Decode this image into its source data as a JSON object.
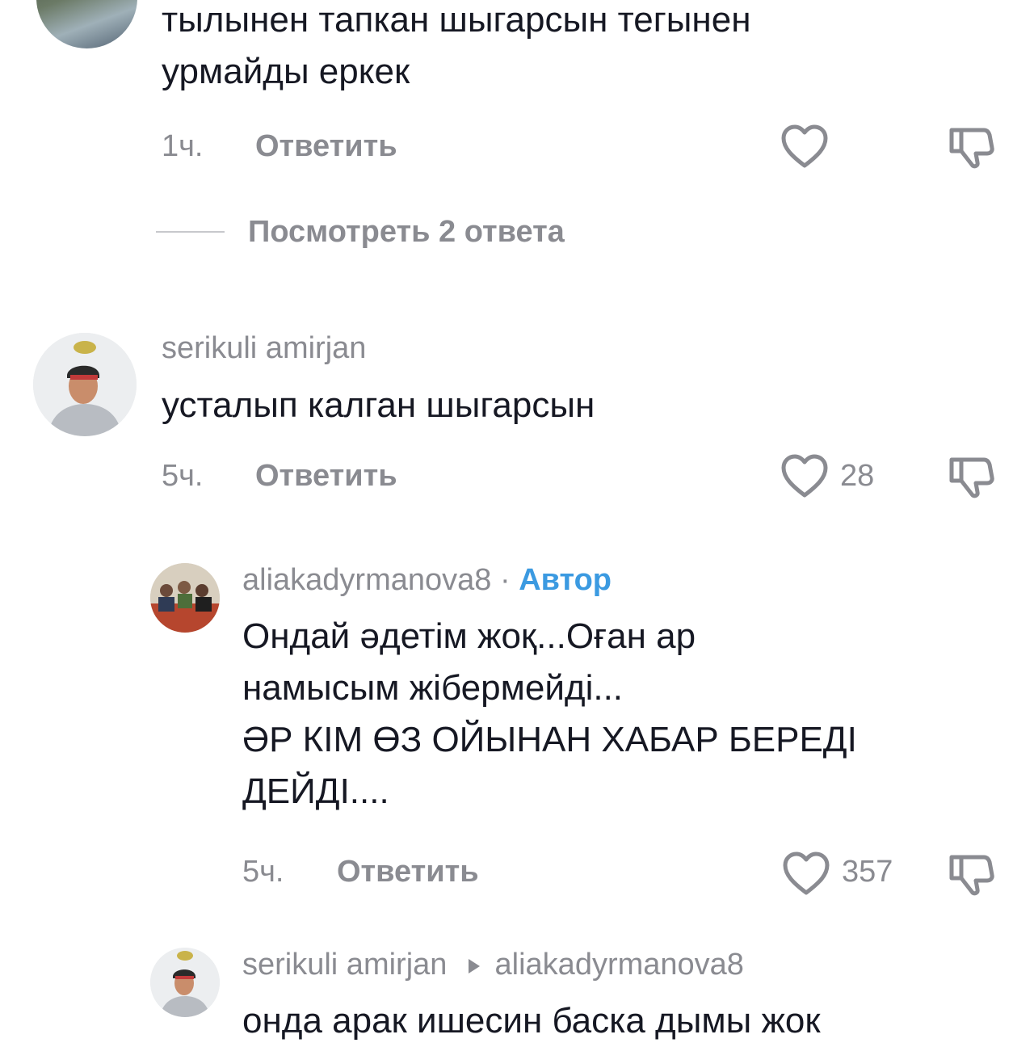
{
  "comments": [
    {
      "username": "",
      "text": "тылынен тапкан шыгарсын тегынен\nурмайды еркек",
      "time": "1ч.",
      "reply": "Ответить",
      "likes": "",
      "view_replies": "Посмотреть 2 ответа"
    },
    {
      "username": "serikuli amirjan",
      "text": "усталып калган шыгарсын",
      "time": "5ч.",
      "reply": "Ответить",
      "likes": "28"
    },
    {
      "username": "aliakadyrmanova8",
      "separator": "·",
      "author_label": "Автор",
      "text": "Ондай әдетім жоқ...Оған ар\nнамысым жібермейді...\nӘР КІМ ӨЗ ОЙЫНАН ХАБАР БЕРЕДІ\nДЕЙДІ....",
      "time": "5ч.",
      "reply": "Ответить",
      "likes": "357"
    },
    {
      "username": "serikuli amirjan",
      "reply_to": "aliakadyrmanova8",
      "text": "онда арак ишесин баска дымы жок"
    }
  ],
  "icons": {
    "like": "heart-icon",
    "dislike": "thumbs-down-icon",
    "reply_arrow": "triangle-right-icon"
  },
  "colors": {
    "text": "#161823",
    "muted": "#8a8b91",
    "author": "#3b9ae1"
  }
}
